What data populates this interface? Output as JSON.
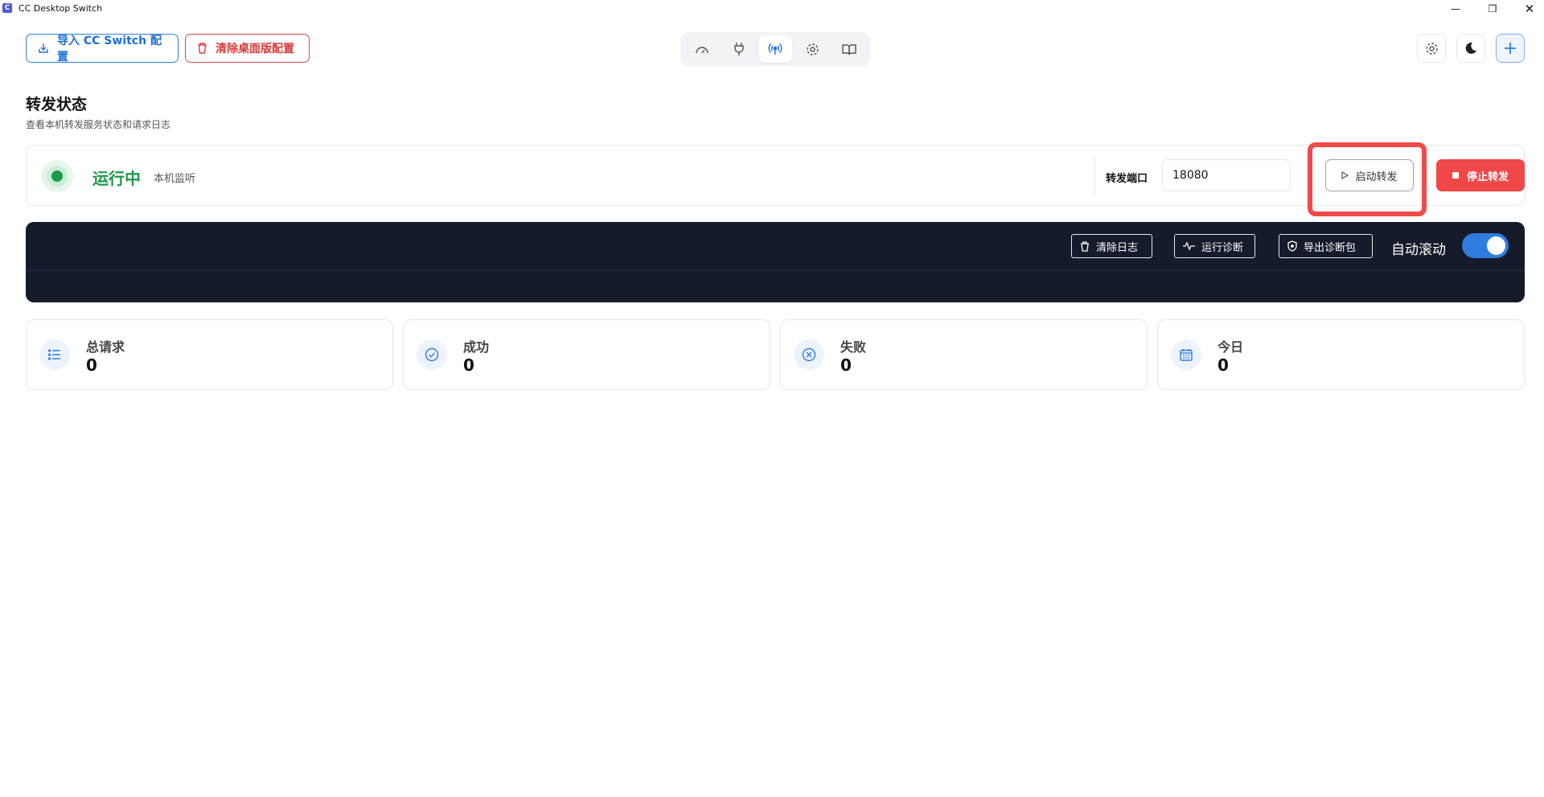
{
  "window": {
    "title": "CC Desktop Switch",
    "minimize": "—",
    "maximize": "❐",
    "close": "✕"
  },
  "toolbar": {
    "import_label": "导入 CC Switch 配置",
    "clear_label": "清除桌面版配置",
    "nav": [
      {
        "icon": "dashboard-icon",
        "active": false
      },
      {
        "icon": "plug-icon",
        "active": false
      },
      {
        "icon": "broadcast-icon",
        "active": true
      },
      {
        "icon": "settings-icon",
        "active": false
      },
      {
        "icon": "book-icon",
        "active": false
      }
    ],
    "right_icons": [
      "gear-icon",
      "moon-icon",
      "plus-icon"
    ]
  },
  "page": {
    "title": "转发状态",
    "subtitle": "查看本机转发服务状态和请求日志"
  },
  "status": {
    "state": "运行中",
    "scope": "本机监听",
    "port_label": "转发端口",
    "port_value": "18080",
    "start_label": "启动转发",
    "stop_label": "停止转发"
  },
  "log": {
    "clear_label": "清除日志",
    "diagnose_label": "运行诊断",
    "export_label": "导出诊断包",
    "autoscroll_label": "自动滚动",
    "autoscroll_on": true
  },
  "stats": [
    {
      "label": "总请求",
      "value": "0",
      "icon": "list-icon"
    },
    {
      "label": "成功",
      "value": "0",
      "icon": "check-circle-icon"
    },
    {
      "label": "失败",
      "value": "0",
      "icon": "x-circle-icon"
    },
    {
      "label": "今日",
      "value": "0",
      "icon": "calendar-icon"
    }
  ],
  "colors": {
    "accent": "#2f7de1",
    "danger": "#f04848",
    "success": "#1c9a48",
    "log_bg": "#161b2b"
  }
}
